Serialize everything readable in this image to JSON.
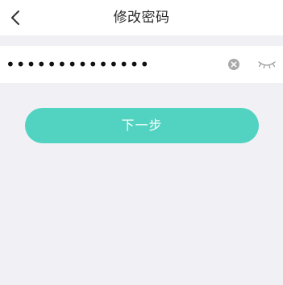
{
  "header": {
    "title": "修改密码",
    "back_icon": "chevron-left-icon"
  },
  "password": {
    "value": "••••••••••••••",
    "clear_icon": "clear-circle-icon",
    "visibility_icon": "eye-closed-icon"
  },
  "next_button": {
    "label": "下一步"
  },
  "colors": {
    "background": "#f1f1f5",
    "surface": "#ffffff",
    "accent": "#52d3c1",
    "icon_gray": "#a9a9a9",
    "text": "#2b2b2b"
  }
}
